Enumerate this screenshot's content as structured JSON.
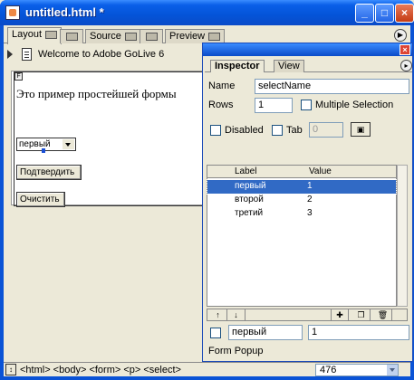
{
  "window": {
    "title": "untitled.html *",
    "minimize_glyph": "_",
    "maximize_glyph": "□",
    "close_glyph": "×"
  },
  "tabs": [
    {
      "label": "Layout",
      "active": true
    },
    {
      "label": "",
      "active": false
    },
    {
      "label": "Source",
      "active": false
    },
    {
      "label": "",
      "active": false
    },
    {
      "label": "Preview",
      "active": false
    }
  ],
  "address": {
    "page_title": "Welcome to Adobe GoLive 6"
  },
  "canvas": {
    "heading": "Это пример простейшей формы",
    "select_value": "первый",
    "submit_label": "Подтвердить",
    "reset_label": "Очистить"
  },
  "inspector": {
    "tab_inspector": "Inspector",
    "tab_view": "View",
    "name_label": "Name",
    "name_value": "selectName",
    "rows_label": "Rows",
    "rows_value": "1",
    "multiple_label": "Multiple Selection",
    "disabled_label": "Disabled",
    "tab_label": "Tab",
    "tab_value": "0",
    "col_label": "Label",
    "col_value": "Value",
    "options": [
      {
        "label": "первый",
        "value": "1",
        "selected": true
      },
      {
        "label": "второй",
        "value": "2",
        "selected": false
      },
      {
        "label": "третий",
        "value": "3",
        "selected": false
      }
    ],
    "edit_label": "первый",
    "edit_value": "1",
    "footer": "Form Popup"
  },
  "status": {
    "tags": "<html> <body> <form> <p> <select>",
    "zoom": "476"
  },
  "colors": {
    "titlebar": "#0a5fe8",
    "selection": "#316ac5"
  }
}
